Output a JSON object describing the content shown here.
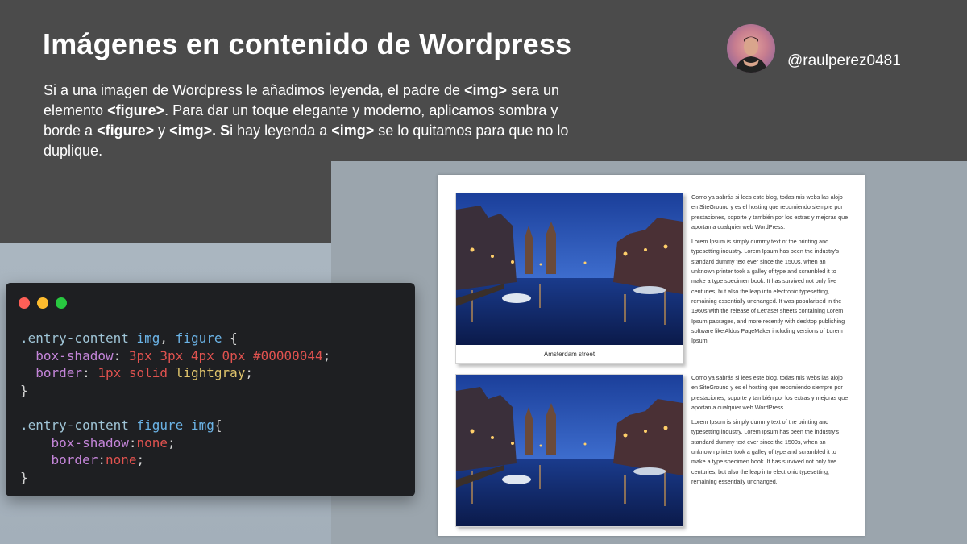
{
  "header": {
    "title": "Imágenes en contenido de Wordpress",
    "handle": "@raulperez0481",
    "intro": {
      "t1": "Si a una imagen de Wordpress le añadimos leyenda, el padre de ",
      "b1": "<img>",
      "t2": " sera un elemento ",
      "b2": "<figure>",
      "t3": ". Para dar un toque elegante y moderno, aplicamos sombra y borde a ",
      "b3": "<figure>",
      "t4": " y ",
      "b4": "<img>. S",
      "t5": "i hay leyenda a ",
      "b5": "<img>",
      "t6": " se lo quitamos para que no lo duplique."
    }
  },
  "code": {
    "l1_sel": ".entry-content ",
    "l1_tag": "img",
    "l1_comma": ", ",
    "l1_tag2": "figure",
    "l1_brace": " {",
    "l2_prop": "  box-shadow",
    "l2_colon": ": ",
    "l2_v1": "3px 3px 4px 0px #00000044",
    "l2_semi": ";",
    "l3_prop": "  border",
    "l3_colon": ": ",
    "l3_num": "1px",
    "l3_kw": " solid ",
    "l3_val": "lightgray",
    "l3_semi": ";",
    "l4": "}",
    "l6_sel": ".entry-content ",
    "l6_tag": "figure img",
    "l6_brace": "{",
    "l7_prop": "    box-shadow",
    "l7_colon": ":",
    "l7_val": "none",
    "l7_semi": ";",
    "l8_prop": "    border",
    "l8_colon": ":",
    "l8_val": "none",
    "l8_semi": ";",
    "l9": "}"
  },
  "article": {
    "caption": "Amsterdam street",
    "p_intro": "Como ya sabrás si lees este blog, todas mis webs las alojo en SiteGround y es el hosting que recomiendo siempre por prestaciones, soporte y también por los extras y mejoras que aportan a cualquier web WordPress.",
    "p_lorem1": "Lorem Ipsum is simply dummy text of the printing and typesetting industry. Lorem Ipsum has been the industry's standard dummy text ever since the 1500s, when an unknown printer took a galley of type and scrambled it to make a type specimen book. It has survived not only five centuries, but also the leap into electronic typesetting, remaining essentially unchanged. It was popularised in the 1960s with the release of Letraset sheets containing Lorem Ipsum passages, and more recently with desktop publishing software like Aldus PageMaker including versions of Lorem Ipsum.",
    "p_intro2": "Como ya sabrás si lees este blog, todas mis webs las alojo en SiteGround y es el hosting que recomiendo siempre por prestaciones, soporte y también por los extras y mejoras que aportan a cualquier web WordPress.",
    "p_lorem2": "Lorem Ipsum is simply dummy text of the printing and typesetting industry. Lorem Ipsum has been the industry's standard dummy text ever since the 1500s, when an unknown printer took a galley of type and scrambled it to make a type specimen book. It has survived not only five centuries, but also the leap into electronic typesetting, remaining essentially unchanged."
  },
  "colors": {
    "background": "#4b4b4b",
    "panel": "#9ba5ad",
    "code_bg": "#1e1f22"
  }
}
